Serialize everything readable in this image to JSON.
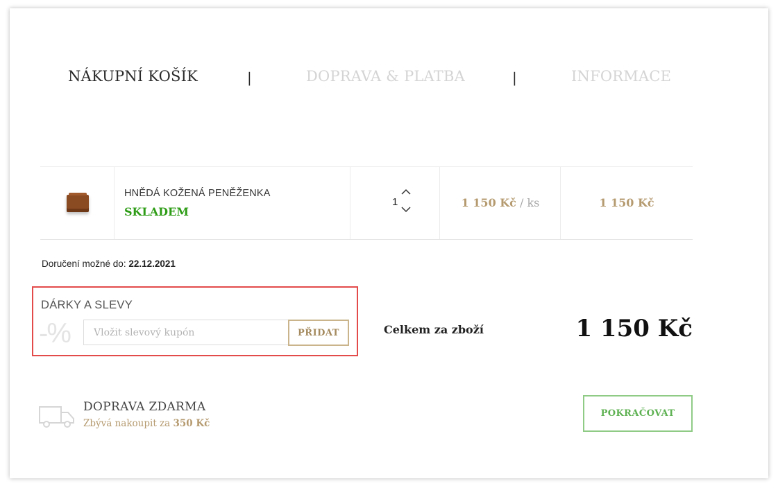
{
  "steps": {
    "cart": "NÁKUPNÍ KOŠÍK",
    "shipping": "DOPRAVA & PLATBA",
    "info": "INFORMACE",
    "separator": "|"
  },
  "cart_item": {
    "name": "HNĚDÁ KOŽENÁ PENĚŽENKA",
    "stock": "SKLADEM",
    "quantity": "1",
    "unit_price": "1 150 Kč",
    "unit_suffix": " / ks",
    "total_price": "1 150 Kč"
  },
  "delivery": {
    "label": "Doručení možné do: ",
    "date": "22.12.2021"
  },
  "discount": {
    "title": "DÁRKY A SLEVY",
    "symbol": "-%",
    "placeholder": "Vložit slevový kupón",
    "button": "PŘIDAT"
  },
  "summary": {
    "label": "Celkem za zboží",
    "amount": "1 150 Kč"
  },
  "shipping": {
    "title": "DOPRAVA ZDARMA",
    "remaining_prefix": "Zbývá nakoupit za ",
    "remaining_amount": "350 Kč"
  },
  "actions": {
    "continue": "POKRAČOVAT"
  },
  "colors": {
    "accent_gold": "#b59a6f",
    "stock_green": "#2e9c16",
    "continue_green": "#8fcb85",
    "highlight_red": "#e34a4a"
  }
}
